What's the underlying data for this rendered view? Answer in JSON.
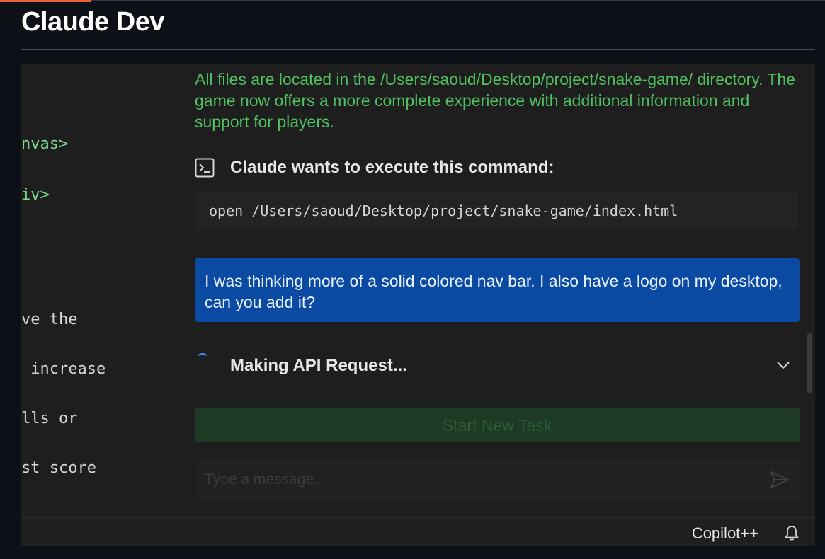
{
  "page": {
    "title": "Claude Dev"
  },
  "editor": {
    "lines": [
      {
        "text": "nvas>",
        "color": "green"
      },
      {
        "text": "iv>",
        "color": "green"
      },
      {
        "text": "ve the",
        "color": "default"
      },
      {
        "text": " increase",
        "color": "default"
      },
      {
        "text": "lls or",
        "color": "default"
      },
      {
        "text": "st score",
        "color": "default"
      }
    ]
  },
  "chat": {
    "completion_text": "All files are located in the /Users/saoud/Desktop/project/snake-game/ directory. The game now offers a more complete experience with additional information and support for players.",
    "command_header": "Claude wants to execute this command:",
    "command_icon": "terminal-icon",
    "command": "open /Users/saoud/Desktop/project/snake-game/index.html",
    "user_message": "I was thinking more of a solid colored nav bar. I also have a logo on my desktop, can you add it?",
    "api_status": "Making API Request...",
    "start_new_task": "Start New Task",
    "input_placeholder": "Type a message..."
  },
  "status_bar": {
    "copilot_label": "Copilot++"
  },
  "colors": {
    "accent": "#e8633a",
    "completion_green": "#4fbf60",
    "user_bubble": "#0a4aa3",
    "spinner": "#3794ff"
  }
}
